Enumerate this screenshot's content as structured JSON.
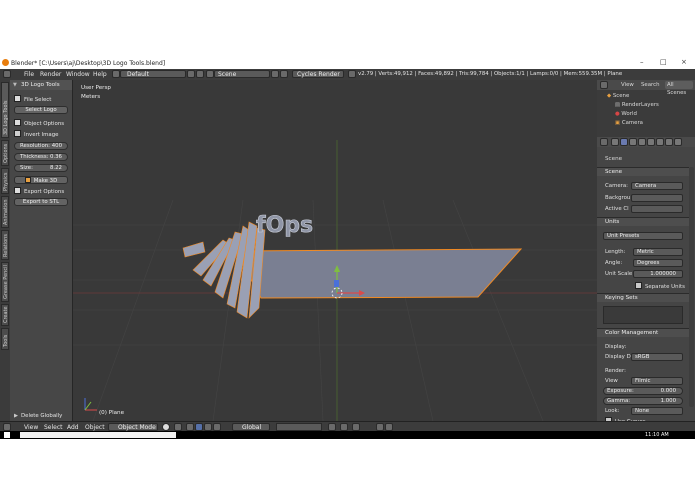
{
  "window": {
    "title": "Blender* [C:\\Users\\aj\\Desktop\\3D Logo Tools.blend]",
    "controls": [
      "–",
      "□",
      "×"
    ]
  },
  "topbar": {
    "menus": [
      "File",
      "Render",
      "Window",
      "Help"
    ],
    "layout": "Default",
    "scene": "Scene",
    "engine": "Cycles Render",
    "stats": "v2.79 | Verts:49,912 | Faces:49,892 | Tris:99,784 | Objects:1/1 | Lamps:0/0 | Mem:559.35M | Plane"
  },
  "vertical_tabs": [
    "3D Logo Tools",
    "Options",
    "Physics",
    "Animation",
    "Relations",
    "Grease Pencil",
    "Create",
    "Tools"
  ],
  "tool_panel": {
    "header": "3D Logo Tools",
    "file_select_label": "File Select",
    "select_logo": "Select Logo",
    "object_options": "Object Options",
    "invert_image": "Invert Image",
    "resolution_label": "Resolution:",
    "resolution_value": "400",
    "thickness_label": "Thickness:",
    "thickness_value": "0.36",
    "size_label": "Size:",
    "size_value": "8.22",
    "make_3d": "Make 3D",
    "export_options": "Export Options",
    "export_stl": "Export to STL",
    "delete_globally": "Delete Globally"
  },
  "viewport": {
    "view_name": "User Persp",
    "units": "Meters",
    "object_label": "(0) Plane",
    "logo_text": "fOps"
  },
  "outliner": {
    "tabs": [
      "View",
      "Search",
      "All Scenes"
    ],
    "items": [
      "Scene",
      "RenderLayers",
      "World",
      "Camera"
    ]
  },
  "properties": {
    "breadcrumb": "Scene",
    "scene_section": "Scene",
    "camera_label": "Camera:",
    "camera_value": "Camera",
    "background_label": "Backgrou",
    "active_clip_label": "Active Cl",
    "units_section": "Units",
    "unit_presets": "Unit Presets",
    "length_label": "Length:",
    "length_value": "Metric",
    "angle_label": "Angle:",
    "angle_value": "Degrees",
    "unit_scale_label": "Unit Scale",
    "unit_scale_value": "1.000000",
    "separate_units": "Separate Units",
    "keying_section": "Keying Sets",
    "color_section": "Color Management",
    "display_label": "Display:",
    "display_device_label": "Display D",
    "display_device_value": "sRGB",
    "render_label": "Render:",
    "view_label": "View",
    "view_value": "Filmic",
    "exposure_label": "Exposure:",
    "exposure_value": "0.000",
    "gamma_label": "Gamma:",
    "gamma_value": "1.000",
    "look_label": "Look:",
    "look_value": "None",
    "use_curves": "Use Curves"
  },
  "bottombar": {
    "menus": [
      "View",
      "Select",
      "Add",
      "Object"
    ],
    "mode": "Object Mode",
    "orientation": "Global"
  },
  "taskbar": {
    "time": "11:10 AM"
  },
  "colors": {
    "viewport_bg": "#393939",
    "panel_bg": "#474747",
    "selection_outline": "#f08a24",
    "axis_x": "#d94b4b",
    "axis_y": "#7fbf3f",
    "axis_z": "#4a70d9"
  }
}
